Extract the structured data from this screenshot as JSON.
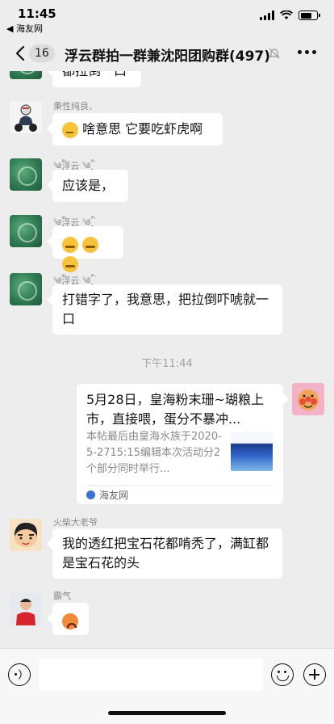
{
  "status": {
    "time": "11:45",
    "back_app": "◀ 海友网",
    "battery_level": 0.7
  },
  "nav": {
    "unread_count": "16",
    "title": "浮云群拍一群兼沈阳团购群(497)"
  },
  "messages": [
    {
      "type": "text",
      "side": "left",
      "sender": "",
      "avatar": "green-coral-avatar",
      "text": "都拉倒一口"
    },
    {
      "type": "text",
      "side": "left",
      "sender": "秉性纯良、",
      "avatar": "motorcycle-avatar",
      "text": "啥意思 它要吃虾虎啊",
      "emoji_prefix": "thinking-face"
    },
    {
      "type": "text",
      "side": "left",
      "sender": "༄྄ི浮云 ༄྄ི",
      "avatar": "green-coral-avatar",
      "text": "应该是，"
    },
    {
      "type": "emoji",
      "side": "left",
      "sender": "༄྄ི浮云 ༄྄ི",
      "avatar": "green-coral-avatar",
      "emojis": [
        "sweat-face",
        "sweat-face",
        "sweat-face"
      ]
    },
    {
      "type": "text",
      "side": "left",
      "sender": "༄྄ི浮云 ༄྄ི",
      "avatar": "green-coral-avatar",
      "text": "打错字了，我意思，把拉倒吓唬就一口"
    },
    {
      "type": "text",
      "side": "left",
      "sender": "火柴大老爷",
      "avatar": "shinchan-avatar",
      "text": "我的透红把宝石花都啃秃了，满缸都是宝石花的头"
    },
    {
      "type": "emoji",
      "side": "left",
      "sender": "霸气",
      "avatar": "red-shirt-avatar",
      "emojis": [
        "angry-face"
      ]
    }
  ],
  "timestamp": "下午11:44",
  "link_card": {
    "title": "5月28日，皇海粉末珊~瑚粮上市，直接喂，蛋分不暴冲...",
    "description": "本帖最后由皇海水族于2020-5-2715:15编辑本次活动分2个部分同时举行...",
    "source": "海友网",
    "thumbnail": "aquarium-fish-thumbnail"
  },
  "input": {
    "placeholder": ""
  },
  "colors": {
    "background": "#ededed",
    "bubble": "#ffffff",
    "meta_text": "#8a8a8a"
  }
}
